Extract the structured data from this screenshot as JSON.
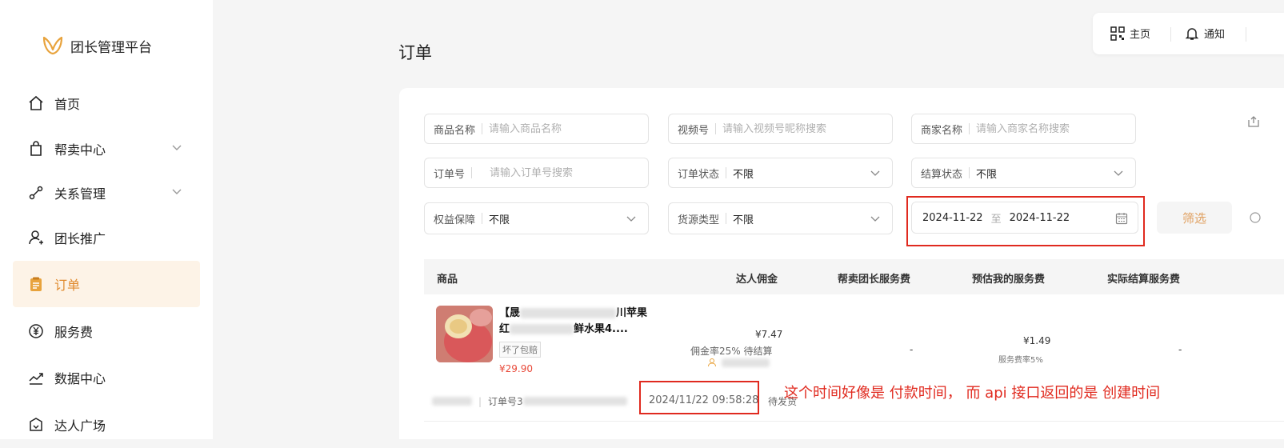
{
  "app": {
    "title": "团长管理平台"
  },
  "sidebar": {
    "items": [
      {
        "label": "首页",
        "icon": "home-icon"
      },
      {
        "label": "帮卖中心",
        "icon": "shopping-bag-icon"
      },
      {
        "label": "关系管理",
        "icon": "relation-icon"
      },
      {
        "label": "团长推广",
        "icon": "user-promote-icon"
      },
      {
        "label": "订单",
        "icon": "order-icon",
        "active": true
      },
      {
        "label": "服务费",
        "icon": "yen-circle-icon"
      },
      {
        "label": "数据中心",
        "icon": "chart-trend-icon"
      },
      {
        "label": "达人广场",
        "icon": "square-icon"
      }
    ]
  },
  "topbar": {
    "home_label": "主页",
    "notify_label": "通知"
  },
  "page": {
    "title": "订单"
  },
  "filters": {
    "product_name": {
      "label": "商品名称",
      "placeholder": "请输入商品名称"
    },
    "video_account": {
      "label": "视频号",
      "placeholder": "请输入视频号昵称搜索"
    },
    "merchant_name": {
      "label": "商家名称",
      "placeholder": "请输入商家名称搜索"
    },
    "order_no": {
      "label": "订单号",
      "placeholder": "请输入订单号搜索"
    },
    "order_status": {
      "label": "订单状态",
      "value": "不限"
    },
    "settle_status": {
      "label": "结算状态",
      "value": "不限"
    },
    "rights": {
      "label": "权益保障",
      "value": "不限"
    },
    "source_type": {
      "label": "货源类型",
      "value": "不限"
    },
    "date_range": {
      "start": "2024-11-22",
      "to": "至",
      "end": "2024-11-22"
    },
    "filter_button": "筛选"
  },
  "table": {
    "columns": [
      "商品",
      "达人佣金",
      "帮卖团长服务费",
      "预估我的服务费",
      "实际结算服务费"
    ],
    "rows": [
      {
        "title_line1_a": "【晟",
        "title_line1_b": "川苹果",
        "title_line2_a": "红",
        "title_line2_b": "鲜水果4....",
        "tag": "坏了包赔",
        "price": "¥29.90",
        "commission": "¥7.47",
        "commission_rate": "佣金率25% 待结算",
        "helper_fee": "-",
        "est_fee": "¥1.49",
        "est_fee_rate": "服务费率5%",
        "actual_fee": "-",
        "order_no_label": "订单号3",
        "time": "2024/11/22 09:58:28",
        "status": "待发货"
      }
    ]
  },
  "annotation": {
    "text": "这个时间好像是  付款时间，   而 api 接口返回的是 创建时间"
  },
  "colors": {
    "accent": "#e08a2e",
    "annotation_red": "#e02a1f",
    "active_bg": "#fdf3e7"
  }
}
